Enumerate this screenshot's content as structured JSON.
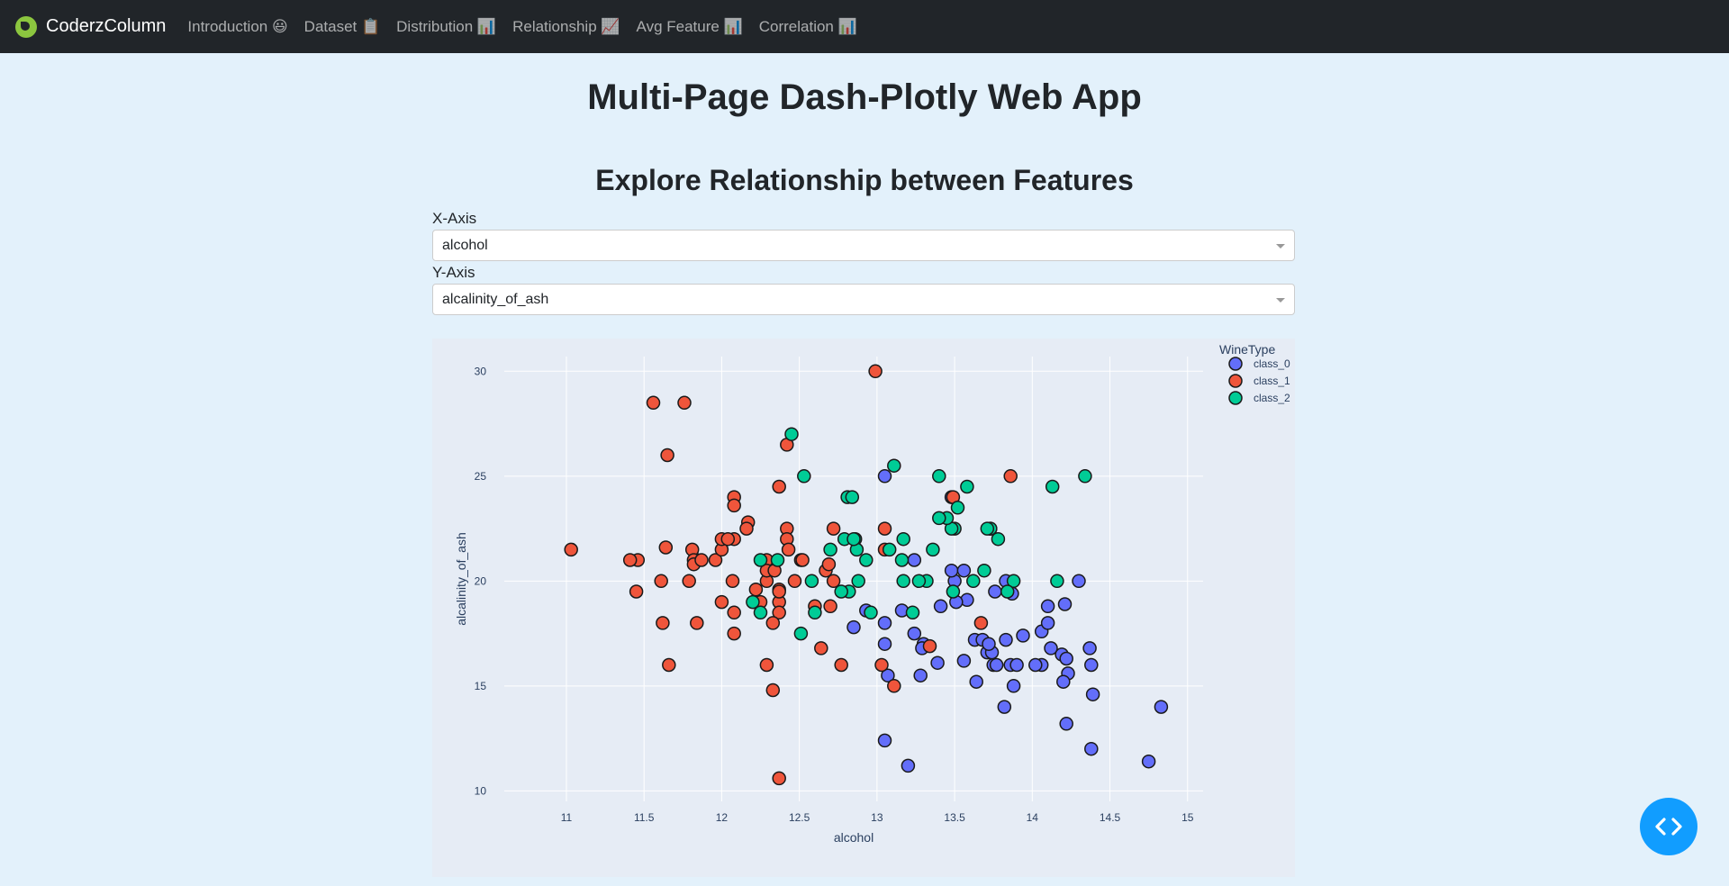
{
  "navbar": {
    "brand": "CoderzColumn",
    "links": [
      "Introduction 😃",
      "Dataset 📋",
      "Distribution 📊",
      "Relationship 📈",
      "Avg Feature 📊",
      "Correlation 📊"
    ]
  },
  "page": {
    "title": "Multi-Page Dash-Plotly Web App",
    "subtitle": "Explore Relationship between Features"
  },
  "controls": {
    "x_label": "X-Axis",
    "x_value": "alcohol",
    "y_label": "Y-Axis",
    "y_value": "alcalinity_of_ash"
  },
  "colors": {
    "class_0": "#636efa",
    "class_1": "#ef553b",
    "class_2": "#00cc96",
    "navbar_bg": "#212529",
    "page_bg": "#e3f1fb",
    "plot_bg": "#e6ecf5",
    "fab": "#119dff"
  },
  "icons": {
    "brand": "leaf-logo-icon",
    "fab": "code-brackets-icon"
  },
  "chart_data": {
    "type": "scatter",
    "xlabel": "alcohol",
    "ylabel": "alcalinity_of_ash",
    "xlim": [
      10.6,
      15.1
    ],
    "ylim": [
      9.5,
      30.7
    ],
    "xticks": [
      11,
      11.5,
      12,
      12.5,
      13,
      13.5,
      14,
      14.5,
      15
    ],
    "yticks": [
      10,
      15,
      20,
      25,
      30
    ],
    "grid": true,
    "legend_title": "WineType",
    "legend_position": "top-right",
    "series": [
      {
        "name": "class_0",
        "points": [
          [
            14.23,
            15.6
          ],
          [
            13.2,
            11.2
          ],
          [
            13.16,
            18.6
          ],
          [
            14.37,
            16.8
          ],
          [
            13.24,
            21
          ],
          [
            14.2,
            15.2
          ],
          [
            14.39,
            14.6
          ],
          [
            14.06,
            17.6
          ],
          [
            14.83,
            14
          ],
          [
            13.86,
            16
          ],
          [
            14.1,
            18
          ],
          [
            14.12,
            16.8
          ],
          [
            13.75,
            16
          ],
          [
            14.75,
            11.4
          ],
          [
            14.38,
            12
          ],
          [
            13.63,
            17.2
          ],
          [
            14.3,
            20
          ],
          [
            13.83,
            20
          ],
          [
            14.19,
            16.5
          ],
          [
            13.64,
            15.2
          ],
          [
            14.06,
            16
          ],
          [
            12.93,
            18.6
          ],
          [
            13.71,
            16.6
          ],
          [
            12.85,
            17.8
          ],
          [
            13.5,
            20
          ],
          [
            13.05,
            25
          ],
          [
            13.39,
            16.1
          ],
          [
            13.3,
            17
          ],
          [
            13.87,
            19.4
          ],
          [
            14.02,
            16
          ],
          [
            13.73,
            22.5
          ],
          [
            13.58,
            19.1
          ],
          [
            13.68,
            17.2
          ],
          [
            13.76,
            19.5
          ],
          [
            13.51,
            19
          ],
          [
            13.48,
            20.5
          ],
          [
            13.28,
            15.5
          ],
          [
            13.05,
            18
          ],
          [
            13.07,
            15.5
          ],
          [
            14.22,
            13.2
          ],
          [
            13.56,
            16.2
          ],
          [
            13.41,
            18.8
          ],
          [
            13.88,
            15
          ],
          [
            13.24,
            17.5
          ],
          [
            13.05,
            17
          ],
          [
            14.21,
            18.9
          ],
          [
            14.38,
            16
          ],
          [
            13.9,
            16
          ],
          [
            14.1,
            18.8
          ],
          [
            13.94,
            17.4
          ],
          [
            13.05,
            12.4
          ],
          [
            13.83,
            17.2
          ],
          [
            13.82,
            14
          ],
          [
            13.77,
            16
          ],
          [
            13.74,
            16.6
          ],
          [
            13.56,
            20.5
          ],
          [
            14.22,
            16.3
          ],
          [
            13.29,
            16.8
          ],
          [
            13.72,
            17
          ],
          [
            13.48,
            24
          ]
        ]
      },
      {
        "name": "class_1",
        "points": [
          [
            12.37,
            10.6
          ],
          [
            12.33,
            14.8
          ],
          [
            12.64,
            16.8
          ],
          [
            13.67,
            18
          ],
          [
            12.37,
            19
          ],
          [
            12.17,
            22.8
          ],
          [
            12.37,
            19.6
          ],
          [
            13.11,
            15
          ],
          [
            12.37,
            18.5
          ],
          [
            13.34,
            16.9
          ],
          [
            12.21,
            19
          ],
          [
            12.29,
            16
          ],
          [
            13.86,
            25
          ],
          [
            13.49,
            24
          ],
          [
            12.99,
            30
          ],
          [
            11.96,
            21
          ],
          [
            11.66,
            16
          ],
          [
            13.03,
            16
          ],
          [
            11.84,
            18
          ],
          [
            12.33,
            18
          ],
          [
            12.7,
            18.8
          ],
          [
            12,
            19
          ],
          [
            12.72,
            22.5
          ],
          [
            12.08,
            17.5
          ],
          [
            13.05,
            21.5
          ],
          [
            11.84,
            21
          ],
          [
            12.67,
            20.5
          ],
          [
            12.16,
            22.5
          ],
          [
            11.65,
            26
          ],
          [
            11.64,
            21.6
          ],
          [
            12.08,
            24
          ],
          [
            12.08,
            23.6
          ],
          [
            12,
            21.5
          ],
          [
            12.69,
            20.8
          ],
          [
            12.29,
            20
          ],
          [
            11.62,
            18
          ],
          [
            12.47,
            20
          ],
          [
            11.81,
            21.5
          ],
          [
            12.29,
            21
          ],
          [
            12.37,
            19.5
          ],
          [
            12.29,
            20.5
          ],
          [
            12.08,
            18.5
          ],
          [
            12.6,
            18.8
          ],
          [
            12.34,
            20.5
          ],
          [
            11.82,
            21
          ],
          [
            12.51,
            21
          ],
          [
            12.42,
            22.5
          ],
          [
            12.25,
            19
          ],
          [
            12.72,
            20
          ],
          [
            12.22,
            19.6
          ],
          [
            11.61,
            20
          ],
          [
            11.46,
            21
          ],
          [
            12.52,
            21
          ],
          [
            11.76,
            28.5
          ],
          [
            11.41,
            21
          ],
          [
            12.08,
            22
          ],
          [
            11.03,
            21.5
          ],
          [
            11.82,
            20.8
          ],
          [
            12.42,
            26.5
          ],
          [
            12.77,
            16
          ],
          [
            12,
            22
          ],
          [
            11.45,
            19.5
          ],
          [
            11.56,
            28.5
          ],
          [
            12.42,
            22
          ],
          [
            13.05,
            22.5
          ],
          [
            11.87,
            21
          ],
          [
            12.07,
            20
          ],
          [
            12.43,
            21.5
          ],
          [
            11.79,
            20
          ],
          [
            12.37,
            24.5
          ],
          [
            12.04,
            22
          ]
        ]
      },
      {
        "name": "class_2",
        "points": [
          [
            12.86,
            22
          ],
          [
            12.88,
            20
          ],
          [
            12.81,
            24
          ],
          [
            12.7,
            21.5
          ],
          [
            12.51,
            17.5
          ],
          [
            12.6,
            18.5
          ],
          [
            12.25,
            21
          ],
          [
            12.53,
            25
          ],
          [
            13.49,
            19.5
          ],
          [
            12.84,
            24
          ],
          [
            12.93,
            21
          ],
          [
            13.36,
            21.5
          ],
          [
            13.52,
            23.5
          ],
          [
            13.62,
            20
          ],
          [
            12.25,
            18.5
          ],
          [
            13.16,
            21
          ],
          [
            13.88,
            20
          ],
          [
            12.87,
            21.5
          ],
          [
            13.32,
            20
          ],
          [
            13.08,
            21.5
          ],
          [
            13.5,
            22.5
          ],
          [
            12.79,
            22
          ],
          [
            13.11,
            25.5
          ],
          [
            13.23,
            18.5
          ],
          [
            12.58,
            20
          ],
          [
            13.17,
            20
          ],
          [
            13.84,
            19.5
          ],
          [
            12.45,
            27
          ],
          [
            14.34,
            25
          ],
          [
            13.48,
            22.5
          ],
          [
            12.36,
            21
          ],
          [
            13.69,
            20.5
          ],
          [
            12.85,
            22
          ],
          [
            12.96,
            18.5
          ],
          [
            13.78,
            22
          ],
          [
            13.73,
            22.5
          ],
          [
            13.45,
            23
          ],
          [
            12.82,
            19.5
          ],
          [
            13.58,
            24.5
          ],
          [
            13.4,
            25
          ],
          [
            12.2,
            19
          ],
          [
            12.77,
            19.5
          ],
          [
            14.16,
            20
          ],
          [
            13.71,
            22.5
          ],
          [
            13.4,
            23
          ],
          [
            13.27,
            20
          ],
          [
            13.17,
            22
          ],
          [
            14.13,
            24.5
          ]
        ]
      }
    ]
  }
}
